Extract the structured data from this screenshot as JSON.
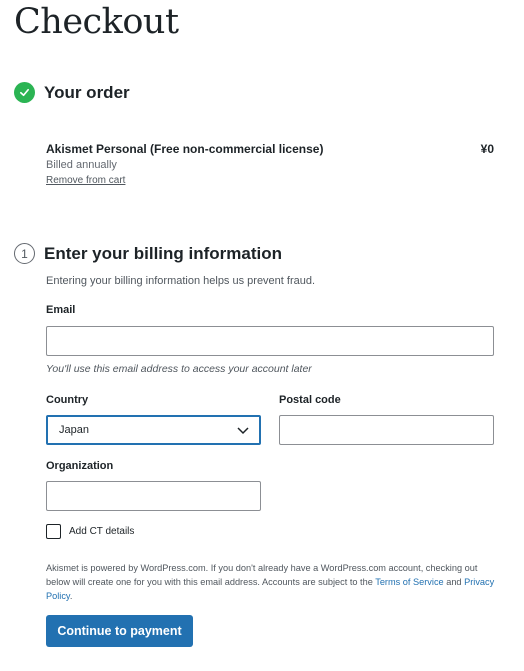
{
  "page_title": "Checkout",
  "order_step": {
    "title": "Your order",
    "item_name": "Akismet Personal (Free non-commercial license)",
    "price": "¥0",
    "billing_period": "Billed annually",
    "remove_link": "Remove from cart"
  },
  "billing_step": {
    "number": "1",
    "title": "Enter your billing information",
    "note": "Entering your billing information helps us prevent fraud."
  },
  "form": {
    "email_label": "Email",
    "email_value": "",
    "email_hint": "You'll use this email address to access your account later",
    "country_label": "Country",
    "country_value": "Japan",
    "postal_label": "Postal code",
    "postal_value": "",
    "organization_label": "Organization",
    "organization_value": "",
    "ct_checkbox_label": "Add CT details",
    "ct_checked": false
  },
  "legal": {
    "text_part1": "Akismet is powered by WordPress.com. If you don't already have a WordPress.com account, checking out below will create one for you with this email address. Accounts are subject to the ",
    "terms_link": "Terms of Service",
    "text_part2": " and ",
    "privacy_link": "Privacy Policy",
    "text_part3": "."
  },
  "continue_button": "Continue to payment",
  "colors": {
    "accent": "#2271b1",
    "success": "#2bb453",
    "text": "#1d2327"
  }
}
